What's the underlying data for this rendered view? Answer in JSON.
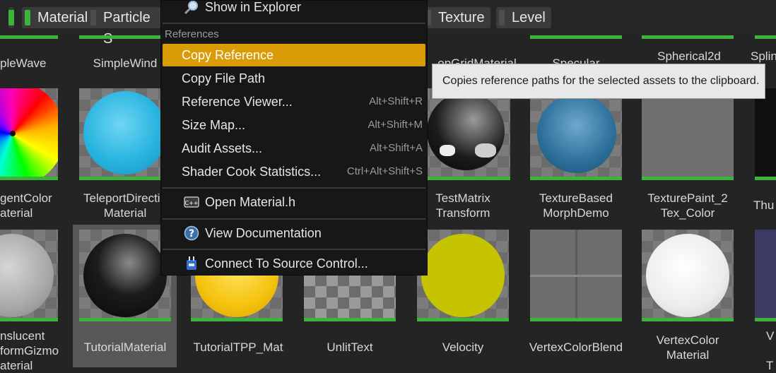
{
  "filters": [
    {
      "label": "Material",
      "active": true
    },
    {
      "label": "Particle S",
      "active": false
    },
    {
      "label": "Texture",
      "active": false
    },
    {
      "label": "Level",
      "active": false
    }
  ],
  "row1_labels": [
    "pleWave",
    "SimpleWind",
    "opGridMaterial",
    "Specular",
    "Spherical2d",
    "Splin"
  ],
  "row2_labels": [
    "gentColor\naterial",
    "TeleportDirectio\nMaterial",
    "TestMatrix\nTransform",
    "TextureBased\nMorphDemo",
    "TexturePaint_2\nTex_Color",
    "Thu"
  ],
  "row3_labels": [
    "nslucent\nformGizmo\naterial",
    "TutorialMaterial",
    "TutorialTPP_Mat",
    "UnlitText",
    "Velocity",
    "VertexColorBlend",
    "VertexColor\nMaterial",
    "V\n\nT"
  ],
  "menu": {
    "show_in_explorer": "Show in Explorer",
    "references_header": "References",
    "copy_reference": "Copy Reference",
    "copy_file_path": "Copy File Path",
    "reference_viewer": "Reference Viewer...",
    "reference_viewer_sc": "Alt+Shift+R",
    "size_map": "Size Map...",
    "size_map_sc": "Alt+Shift+M",
    "audit_assets": "Audit Assets...",
    "audit_assets_sc": "Alt+Shift+A",
    "shader_cook": "Shader Cook Statistics...",
    "shader_cook_sc": "Ctrl+Alt+Shift+S",
    "open_material_h": "Open Material.h",
    "view_documentation": "View Documentation",
    "connect_source_control": "Connect To Source Control..."
  },
  "tooltip": "Copies reference paths for the selected assets to the clipboard.",
  "colors": {
    "accent": "#d99b06",
    "asset_material": "#3cb43c"
  },
  "icons": [
    "magnifier-icon",
    "cpp-file-icon",
    "help-icon",
    "source-control-icon"
  ]
}
